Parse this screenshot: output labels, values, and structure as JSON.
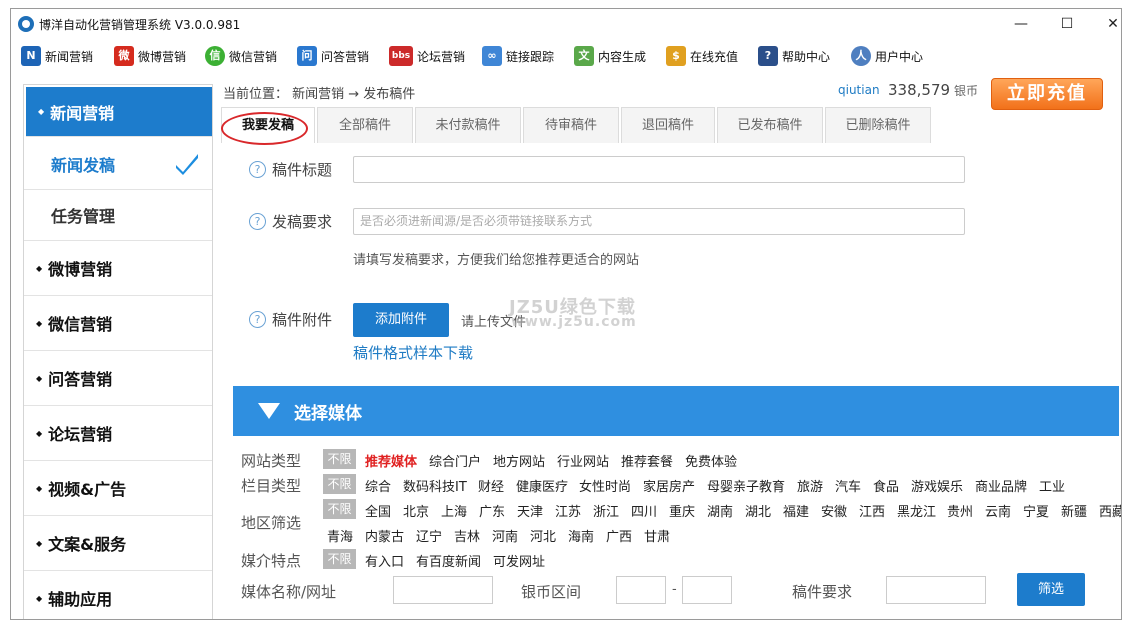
{
  "window": {
    "title": "博洋自动化营销管理系统 V3.0.0.981",
    "controls": [
      "—",
      "☐",
      "✕"
    ]
  },
  "toolbar": [
    {
      "label": "新闻营销",
      "icon": "news-n-icon",
      "color": "#1d64b6",
      "glyph": "N"
    },
    {
      "label": "微博营销",
      "icon": "weibo-icon",
      "color": "#d52b1e",
      "glyph": "微"
    },
    {
      "label": "微信营销",
      "icon": "wechat-icon",
      "color": "#3cb034",
      "glyph": "信"
    },
    {
      "label": "问答营销",
      "icon": "qa-icon",
      "color": "#2a78cf",
      "glyph": "问"
    },
    {
      "label": "论坛营销",
      "icon": "bbs-icon",
      "color": "#cc2a2a",
      "glyph": "bbs"
    },
    {
      "label": "链接跟踪",
      "icon": "link-icon",
      "color": "#3f86d6",
      "glyph": "∞"
    },
    {
      "label": "内容生成",
      "icon": "document-icon",
      "color": "#5aa84a",
      "glyph": "文"
    },
    {
      "label": "在线充值",
      "icon": "money-bag-icon",
      "color": "#e0a020",
      "glyph": "$"
    },
    {
      "label": "帮助中心",
      "icon": "help-icon",
      "color": "#2b4f8a",
      "glyph": "?"
    },
    {
      "label": "用户中心",
      "icon": "user-icon",
      "color": "#4f7fc0",
      "glyph": "人"
    }
  ],
  "sidebar": {
    "items": [
      {
        "label": "新闻营销",
        "active": true
      },
      {
        "label": "新闻发稿",
        "sub": true,
        "current": true
      },
      {
        "label": "任务管理",
        "sub": true
      },
      {
        "label": "微博营销"
      },
      {
        "label": "微信营销"
      },
      {
        "label": "问答营销"
      },
      {
        "label": "论坛营销"
      },
      {
        "label": "视频&广告"
      },
      {
        "label": "文案&服务"
      },
      {
        "label": "辅助应用"
      }
    ]
  },
  "header": {
    "breadcrumb": "当前位置： 新闻营销 → 发布稿件",
    "username": "qiutian",
    "balance": "338,579",
    "balance_unit": "银币",
    "recharge_label": "立即充值"
  },
  "tabs": [
    "我要发稿",
    "全部稿件",
    "未付款稿件",
    "待审稿件",
    "退回稿件",
    "已发布稿件",
    "已删除稿件"
  ],
  "form": {
    "title_label": "稿件标题",
    "title_value": "",
    "req_label": "发稿要求",
    "req_placeholder": "是否必须进新闻源/是否必须带链接联系方式",
    "req_hint": "请填写发稿要求，方便我们给您推荐更适合的网站",
    "attach_label": "稿件附件",
    "attach_button": "添加附件",
    "attach_hint": "请上传文件",
    "sample_link": "稿件格式样本下载"
  },
  "watermark": {
    "line1": "JZ5U绿色下载",
    "line2": "www.jz5u.com"
  },
  "media": {
    "header": "选择媒体",
    "unlimited": "不限",
    "site_type_label": "网站类型",
    "site_types": [
      "推荐媒体",
      "综合门户",
      "地方网站",
      "行业网站",
      "推荐套餐",
      "免费体验"
    ],
    "column_type_label": "栏目类型",
    "column_types": [
      "综合",
      "数码科技IT",
      "财经",
      "健康医疗",
      "女性时尚",
      "家居房产",
      "母婴亲子教育",
      "旅游",
      "汽车",
      "食品",
      "游戏娱乐",
      "商业品牌",
      "工业"
    ],
    "region_label": "地区筛选",
    "regions_row1": [
      "全国",
      "北京",
      "上海",
      "广东",
      "天津",
      "江苏",
      "浙江",
      "四川",
      "重庆",
      "湖南",
      "湖北",
      "福建",
      "安徽",
      "江西",
      "黑龙江",
      "贵州",
      "云南",
      "宁夏",
      "新疆",
      "西藏"
    ],
    "regions_row2": [
      "青海",
      "内蒙古",
      "辽宁",
      "吉林",
      "河南",
      "河北",
      "海南",
      "广西",
      "甘肃"
    ],
    "feature_label": "媒介特点",
    "features": [
      "有入口",
      "有百度新闻",
      "可发网址"
    ],
    "search_label": "媒体名称/网址",
    "coin_label": "银币区间",
    "coin_sep": "-",
    "req_label": "稿件要求",
    "filter_button": "筛选"
  }
}
